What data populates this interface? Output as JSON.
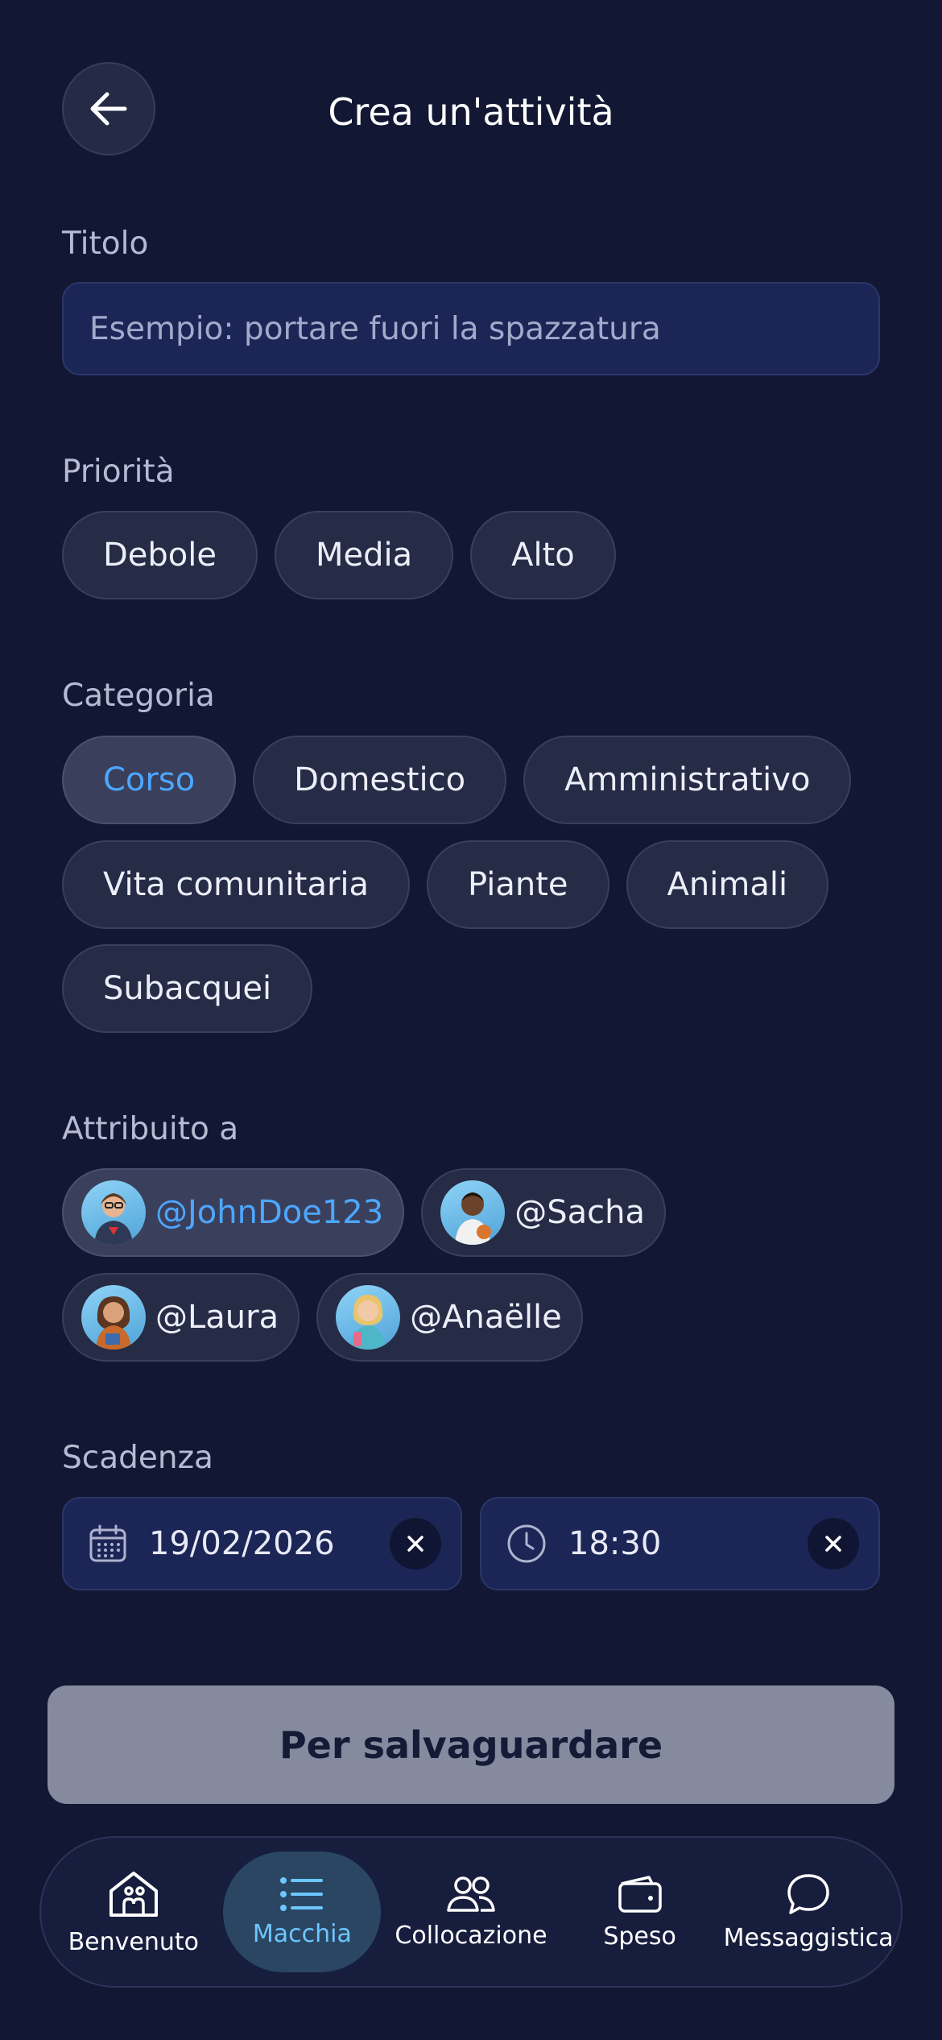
{
  "header": {
    "title": "Crea un'attività"
  },
  "title_field": {
    "label": "Titolo",
    "placeholder": "Esempio: portare fuori la spazzatura"
  },
  "priority": {
    "label": "Priorità",
    "options": [
      "Debole",
      "Media",
      "Alto"
    ]
  },
  "category": {
    "label": "Categoria",
    "selected": "Corso",
    "options": [
      "Corso",
      "Domestico",
      "Amministrativo",
      "Vita comunitaria",
      "Piante",
      "Animali",
      "Subacquei"
    ]
  },
  "assigned": {
    "label": "Attribuito a",
    "selected": "@JohnDoe123",
    "users": [
      "@JohnDoe123",
      "@Sacha",
      "@Laura",
      "@Anaëlle"
    ]
  },
  "deadline": {
    "label": "Scadenza",
    "date": "19/02/2026",
    "time": "18:30"
  },
  "save_label": "Per salvaguardare",
  "nav": {
    "active": "Macchia",
    "items": [
      {
        "label": "Benvenuto",
        "icon": "home-icon"
      },
      {
        "label": "Macchia",
        "icon": "list-icon"
      },
      {
        "label": "Collocazione",
        "icon": "people-icon"
      },
      {
        "label": "Speso",
        "icon": "wallet-icon"
      },
      {
        "label": "Messaggistica",
        "icon": "chat-icon"
      }
    ]
  },
  "colors": {
    "background": "#121733",
    "accent": "#4da6ff",
    "nav_active": "#6cc7ff"
  }
}
